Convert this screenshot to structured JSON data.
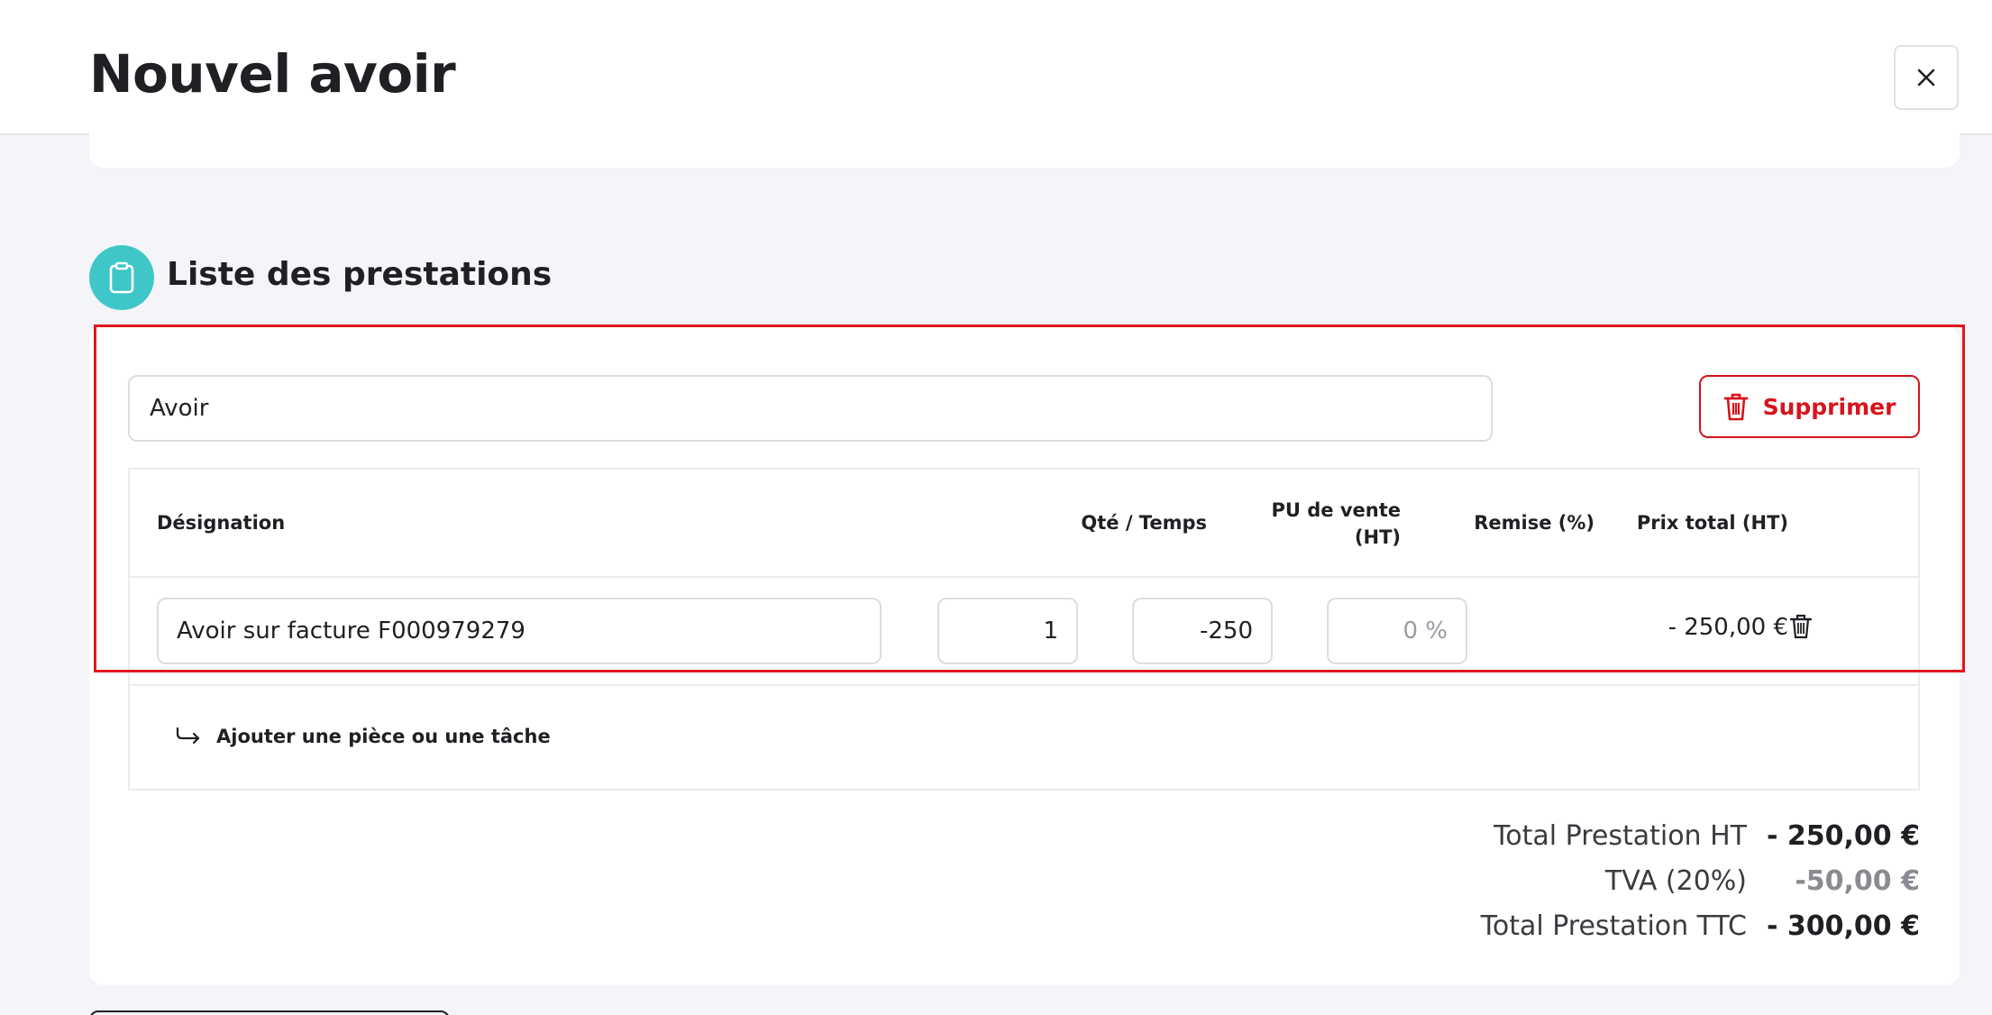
{
  "header": {
    "title": "Nouvel avoir",
    "close_icon": "close-icon"
  },
  "section": {
    "title": "Liste des prestations",
    "icon": "clipboard-icon"
  },
  "group": {
    "name": "Avoir",
    "delete_label": "Supprimer"
  },
  "table": {
    "headers": {
      "designation": "Désignation",
      "qty": "Qté / Temps",
      "pu_line1": "PU de vente",
      "pu_line2": "(HT)",
      "discount": "Remise (%)",
      "total": "Prix total (HT)"
    },
    "rows": [
      {
        "designation": "Avoir sur facture F000979279",
        "qty": "1",
        "unit_price": "-250",
        "discount_placeholder": "0 %",
        "total": "- 250,00 €"
      }
    ],
    "add_label": "Ajouter une pièce ou une tâche"
  },
  "totals": {
    "ht_label": "Total Prestation HT",
    "ht_value": "- 250,00 €",
    "tva_label": "TVA (20%)",
    "tva_value": "-50,00 €",
    "ttc_label": "Total Prestation TTC",
    "ttc_value": "- 300,00 €"
  },
  "colors": {
    "accent_teal": "#3fc6c8",
    "danger": "#d8141b",
    "highlight": "#e3161b"
  }
}
